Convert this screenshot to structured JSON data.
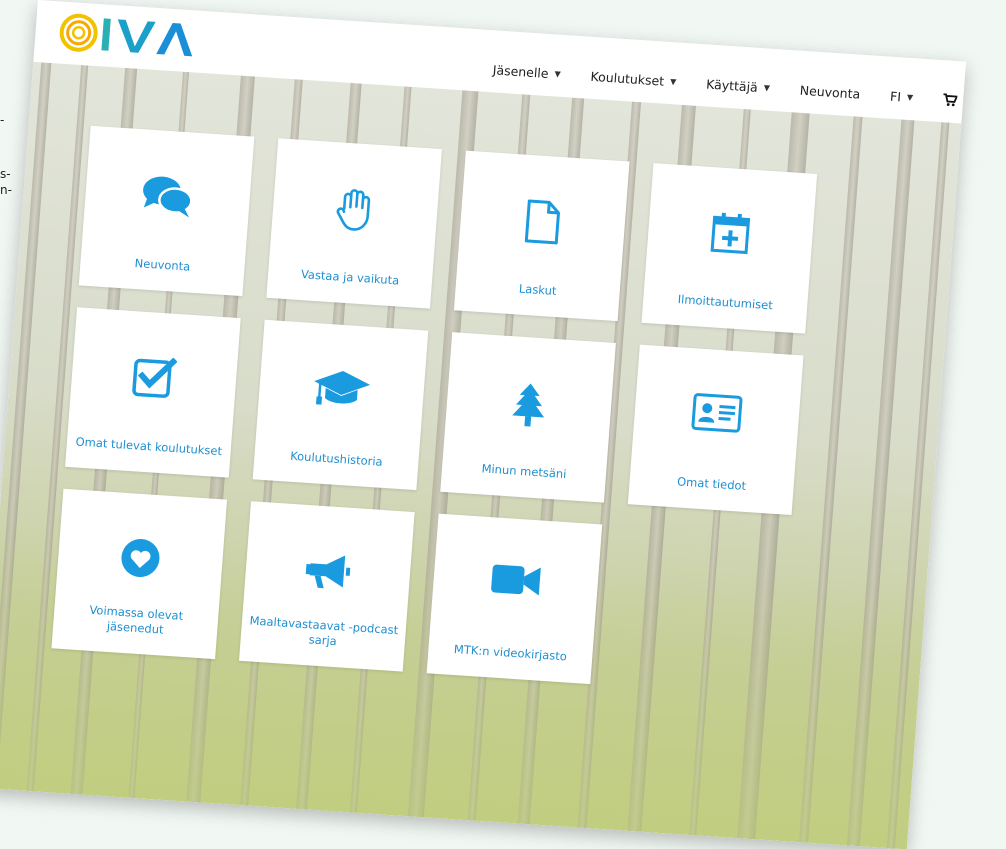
{
  "brand": {
    "logo_text": "OIVA",
    "primary_color": "#1a9be0"
  },
  "nav": {
    "items": [
      {
        "label": "Jäsenelle",
        "dropdown": true
      },
      {
        "label": "Koulutukset",
        "dropdown": true
      },
      {
        "label": "Käyttäjä",
        "dropdown": true
      },
      {
        "label": "Neuvonta",
        "dropdown": false
      },
      {
        "label": "FI",
        "dropdown": true
      }
    ],
    "cart_icon": "shopping-cart-icon"
  },
  "tiles": [
    {
      "label": "Neuvonta",
      "icon": "chat-bubbles-icon"
    },
    {
      "label": "Vastaa ja vaikuta",
      "icon": "hand-icon"
    },
    {
      "label": "Laskut",
      "icon": "document-icon"
    },
    {
      "label": "Ilmoittautumiset",
      "icon": "calendar-plus-icon"
    },
    {
      "label": "Omat tulevat koulutukset",
      "icon": "checkbox-icon"
    },
    {
      "label": "Koulutushistoria",
      "icon": "graduation-cap-icon"
    },
    {
      "label": "Minun metsäni",
      "icon": "tree-icon"
    },
    {
      "label": "Omat tiedot",
      "icon": "id-card-icon"
    },
    {
      "label": "Voimassa olevat jäsenedut",
      "icon": "heart-circle-icon"
    },
    {
      "label": "Maaltavastaavat -podcast sarja",
      "icon": "megaphone-icon"
    },
    {
      "label": "MTK:n videokirjasto",
      "icon": "video-camera-icon"
    }
  ],
  "edge_text": {
    "line1": "-",
    "line2": "s-",
    "line3": "n-"
  }
}
